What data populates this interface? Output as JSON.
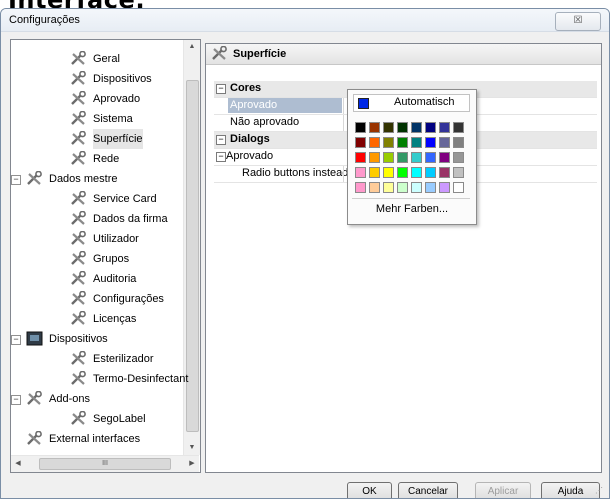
{
  "page_heading": "Interface:",
  "window": {
    "title": "Configurações",
    "close_glyph": "☒"
  },
  "tree": {
    "items": [
      {
        "label": "Geral",
        "level": 2,
        "icon": "tools-icon"
      },
      {
        "label": "Dispositivos",
        "level": 2,
        "icon": "tools-icon"
      },
      {
        "label": "Aprovado",
        "level": 2,
        "icon": "tools-icon"
      },
      {
        "label": "Sistema",
        "level": 2,
        "icon": "tools-icon"
      },
      {
        "label": "Superfície",
        "level": 2,
        "icon": "tools-icon",
        "selected": true
      },
      {
        "label": "Rede",
        "level": 2,
        "icon": "tools-icon"
      },
      {
        "label": "Dados mestre",
        "level": 1,
        "icon": "tools-icon",
        "expander": "−"
      },
      {
        "label": "Service Card",
        "level": 2,
        "icon": "tools-icon"
      },
      {
        "label": "Dados da firma",
        "level": 2,
        "icon": "tools-icon"
      },
      {
        "label": "Utilizador",
        "level": 2,
        "icon": "tools-icon"
      },
      {
        "label": "Grupos",
        "level": 2,
        "icon": "tools-icon"
      },
      {
        "label": "Auditoria",
        "level": 2,
        "icon": "tools-icon"
      },
      {
        "label": "Configurações",
        "level": 2,
        "icon": "tools-icon"
      },
      {
        "label": "Licenças",
        "level": 2,
        "icon": "tools-icon"
      },
      {
        "label": "Dispositivos",
        "level": 1,
        "icon": "device-icon",
        "expander": "−"
      },
      {
        "label": "Esterilizador",
        "level": 2,
        "icon": "tools-icon"
      },
      {
        "label": "Termo-Desinfectant",
        "level": 2,
        "icon": "tools-icon"
      },
      {
        "label": "Add-ons",
        "level": 1,
        "icon": "tools-icon",
        "expander": "−"
      },
      {
        "label": "SegoLabel",
        "level": 2,
        "icon": "tools-icon"
      },
      {
        "label": "External interfaces",
        "level": 1,
        "icon": "tools-icon"
      }
    ],
    "hscroll_thumb": "III"
  },
  "panel": {
    "title": "Superfície"
  },
  "grid": {
    "rows": [
      {
        "type": "category",
        "label": "Cores"
      },
      {
        "type": "property",
        "label": "Aprovado",
        "selected": true
      },
      {
        "type": "property",
        "label": "Não aprovado",
        "value_color": "#e23a33"
      },
      {
        "type": "category",
        "label": "Dialogs"
      },
      {
        "type": "subcategory",
        "label": "Aprovado"
      },
      {
        "type": "property",
        "label": "Radio buttons instead ...",
        "checkbox": true
      }
    ]
  },
  "color_popup": {
    "automatic_label": "Automatisch",
    "automatic_color": "#0028e6",
    "more_colors_label": "Mehr Farben...",
    "palette": [
      [
        "#000000",
        "#993300",
        "#333300",
        "#003300",
        "#003366",
        "#000080",
        "#333399",
        "#333333"
      ],
      [
        "#800000",
        "#ff6600",
        "#808000",
        "#008000",
        "#008080",
        "#0000ff",
        "#666699",
        "#808080"
      ],
      [
        "#ff0000",
        "#ff9900",
        "#99cc00",
        "#339966",
        "#33cccc",
        "#3366ff",
        "#800080",
        "#969696"
      ],
      [
        "#ff99cc",
        "#ffcc00",
        "#ffff00",
        "#00ff00",
        "#00ffff",
        "#00ccff",
        "#993366",
        "#c0c0c0"
      ],
      [
        "#ff99cc",
        "#ffcc99",
        "#ffff99",
        "#ccffcc",
        "#ccffff",
        "#99ccff",
        "#cc99ff",
        "#ffffff"
      ]
    ]
  },
  "buttons": {
    "ok": "OK",
    "cancel": "Cancelar",
    "apply": "Aplicar",
    "help": "Ajuda"
  }
}
